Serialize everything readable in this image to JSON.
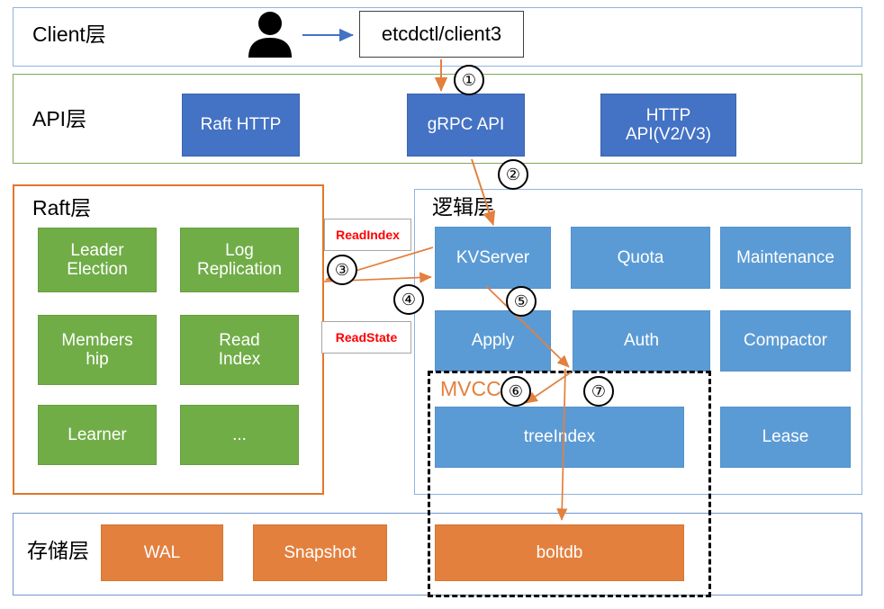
{
  "diagram": {
    "title": "etcd architecture layers",
    "colors": {
      "api_box": "#4472C4",
      "logic_box": "#5B9BD5",
      "raft_box": "#70AD47",
      "storage_box": "#E3803E",
      "arrow": "#E3803E",
      "client_arrow": "#4472C4",
      "tag_text": "#FF0000",
      "mvcc_text": "#E3803E"
    }
  },
  "layers": {
    "client": {
      "title": "Client层",
      "client_box": "etcdctl/client3",
      "person_icon": "user-icon"
    },
    "api": {
      "title": "API层",
      "boxes": [
        {
          "label": "Raft HTTP"
        },
        {
          "label": "gRPC API"
        },
        {
          "label": "HTTP\nAPI(V2/V3)"
        }
      ]
    },
    "raft": {
      "title": "Raft层",
      "boxes": [
        {
          "label": "Leader\nElection"
        },
        {
          "label": "Log\nReplication"
        },
        {
          "label": "Members\nhip"
        },
        {
          "label": "Read\nIndex"
        },
        {
          "label": "Learner"
        },
        {
          "label": "..."
        }
      ]
    },
    "logic": {
      "title": "逻辑层",
      "boxes": [
        {
          "label": "KVServer"
        },
        {
          "label": "Quota"
        },
        {
          "label": "Maintenance"
        },
        {
          "label": "Apply"
        },
        {
          "label": "Auth"
        },
        {
          "label": "Compactor"
        },
        {
          "label": "treeIndex"
        },
        {
          "label": "Lease"
        }
      ],
      "mvcc_label": "MVCC"
    },
    "storage": {
      "title": "存储层",
      "boxes": [
        {
          "label": "WAL"
        },
        {
          "label": "Snapshot"
        },
        {
          "label": "boltdb"
        }
      ]
    }
  },
  "tags": [
    {
      "label": "ReadIndex"
    },
    {
      "label": "ReadState"
    }
  ],
  "step_markers": [
    {
      "label": "①"
    },
    {
      "label": "②"
    },
    {
      "label": "③"
    },
    {
      "label": "④"
    },
    {
      "label": "⑤"
    },
    {
      "label": "⑥"
    },
    {
      "label": "⑦"
    }
  ]
}
